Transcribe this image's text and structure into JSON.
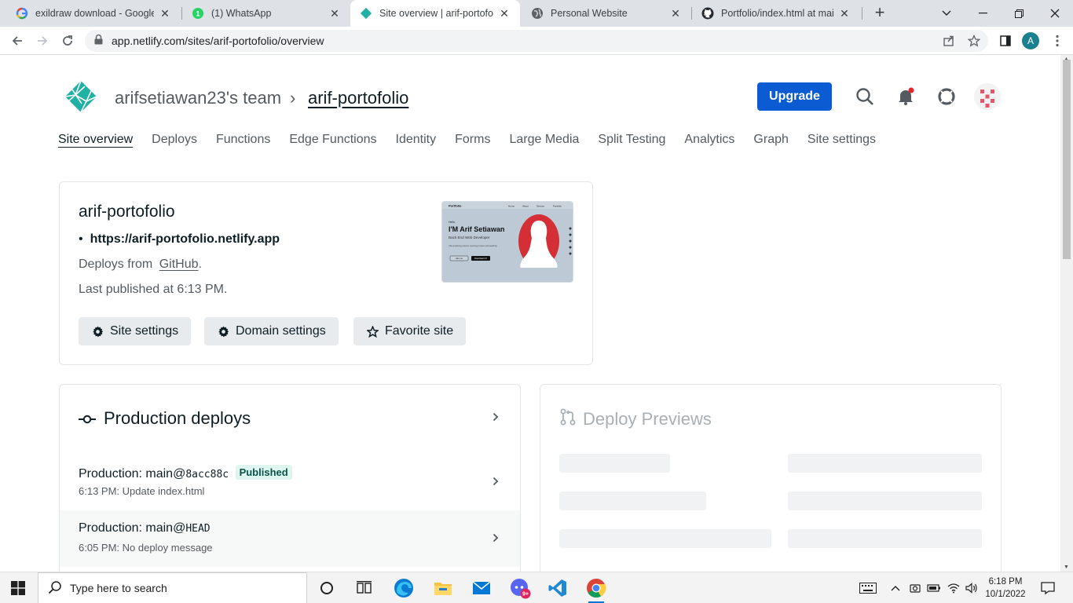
{
  "browser": {
    "tabs": [
      {
        "title": "exildraw download - Google",
        "icon": "google-icon"
      },
      {
        "title": "(1) WhatsApp",
        "icon": "whatsapp-icon"
      },
      {
        "title": "Site overview | arif-portofolio",
        "icon": "netlify-icon",
        "active": true
      },
      {
        "title": "Personal Website",
        "icon": "globe-icon"
      },
      {
        "title": "Portfolio/index.html at main",
        "icon": "github-icon"
      }
    ],
    "url": "app.netlify.com/sites/arif-portofolio/overview",
    "profile_initial": "A"
  },
  "header": {
    "team": "arifsetiawan23's team",
    "separator": "›",
    "site": "arif-portofolio",
    "upgrade_label": "Upgrade"
  },
  "nav": [
    {
      "label": "Site overview",
      "active": true
    },
    {
      "label": "Deploys"
    },
    {
      "label": "Functions"
    },
    {
      "label": "Edge Functions"
    },
    {
      "label": "Identity"
    },
    {
      "label": "Forms"
    },
    {
      "label": "Large Media"
    },
    {
      "label": "Split Testing"
    },
    {
      "label": "Analytics"
    },
    {
      "label": "Graph"
    },
    {
      "label": "Site settings"
    }
  ],
  "site_card": {
    "name": "arif-portofolio",
    "url": "https://arif-portofolio.netlify.app",
    "deploys_from_label": "Deploys from",
    "deploys_from_link": "GitHub",
    "deploys_from_suffix": ".",
    "last_published": "Last published at 6:13 PM.",
    "buttons": {
      "site_settings": "Site settings",
      "domain_settings": "Domain settings",
      "favorite": "Favorite site"
    },
    "preview": {
      "brand": "Portfolio",
      "nav": [
        "Home",
        "About",
        "Service",
        "Portfolio"
      ],
      "hello": "Hello,",
      "headline": "I'M Arif Setiawan",
      "role": "Back End Web Developer",
      "blurb": "I like exploring science, learning to learn and teaching",
      "btn1": "Hire me",
      "btn2": "Download CV"
    }
  },
  "production": {
    "title": "Production deploys",
    "rows": [
      {
        "label": "Production:",
        "branch": "main@",
        "ref": "8acc88c",
        "badge": "Published",
        "detail": "6:13 PM: Update index.html"
      },
      {
        "label": "Production:",
        "branch": "main@",
        "ref": "HEAD",
        "badge": "",
        "detail": "6:05 PM: No deploy message"
      }
    ]
  },
  "previews": {
    "title": "Deploy Previews"
  },
  "taskbar": {
    "search_placeholder": "Type here to search",
    "time": "6:18 PM",
    "date": "10/1/2022",
    "mail_badge": "9+"
  },
  "colors": {
    "accent": "#0b5bd3",
    "netlify_teal": "#20b1a5",
    "published_bg": "#dff6f0"
  }
}
